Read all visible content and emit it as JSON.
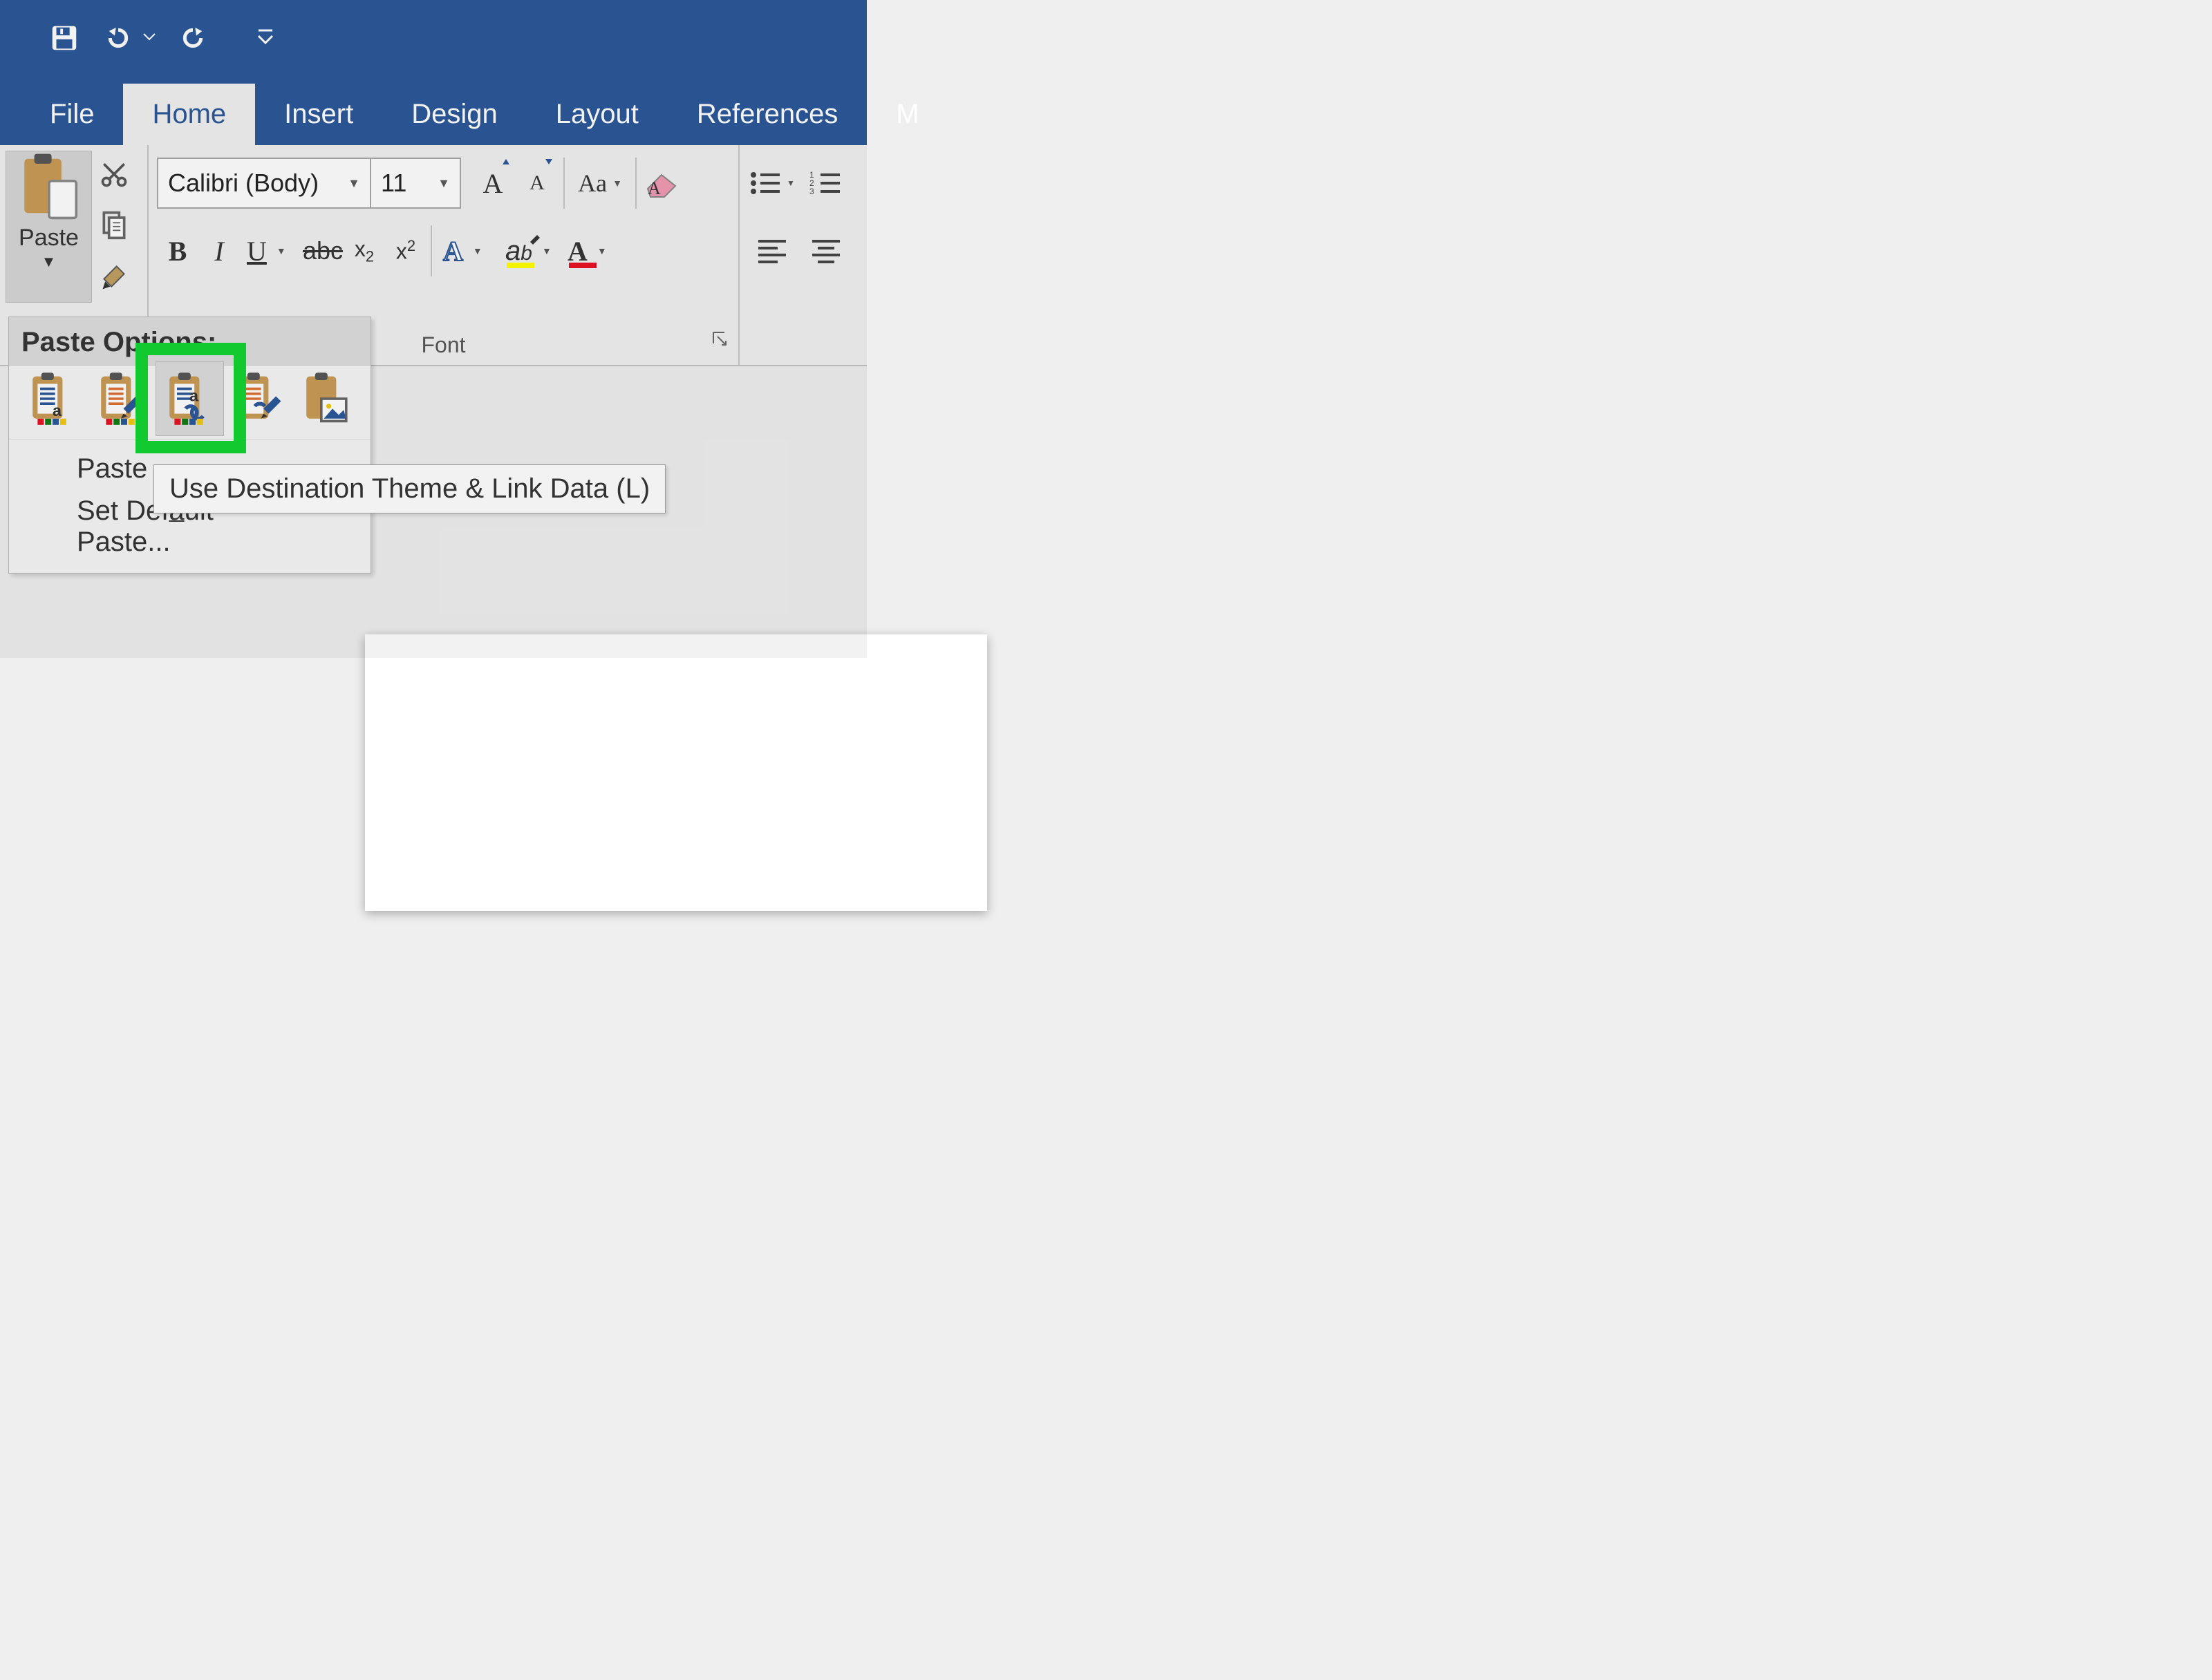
{
  "qat": {
    "save_title": "Save",
    "undo_title": "Undo",
    "redo_title": "Redo",
    "customize_title": "Customize Quick Access Toolbar"
  },
  "tabs": {
    "file": "File",
    "home": "Home",
    "insert": "Insert",
    "design": "Design",
    "layout": "Layout",
    "references": "References",
    "more": "M"
  },
  "clipboard": {
    "paste_label": "Paste",
    "cut_title": "Cut",
    "copy_title": "Copy",
    "format_painter_title": "Format Painter"
  },
  "font": {
    "font_name": "Calibri (Body)",
    "font_size": "11",
    "grow_title": "Increase Font Size",
    "shrink_title": "Decrease Font Size",
    "change_case": "Aa",
    "clear_formatting_title": "Clear All Formatting",
    "bold": "B",
    "italic": "I",
    "underline": "U",
    "strike": "abc",
    "subscript": "x",
    "subscript_sub": "2",
    "superscript": "x",
    "superscript_sup": "2",
    "text_effects": "A",
    "highlight": "ab",
    "font_color": "A",
    "group_label": "Font"
  },
  "paragraph": {
    "bullets_title": "Bullets",
    "numbering_title": "Numbering",
    "align_left_title": "Align Left",
    "align_center_title": "Center"
  },
  "paste_options": {
    "header": "Paste Options:",
    "opt1_title": "Use Destination Theme & Embed Workbook",
    "opt2_title": "Keep Source Formatting & Embed Workbook",
    "opt3_title": "Use Destination Theme & Link Data",
    "opt4_title": "Keep Source Formatting & Link Data",
    "opt5_title": "Picture",
    "paste_special_prefix": "Paste",
    "set_default_prefix": "Set Def",
    "set_default_underline": "a",
    "set_default_suffix": "ult Paste..."
  },
  "tooltip": {
    "text": "Use Destination Theme & Link Data (L)"
  }
}
